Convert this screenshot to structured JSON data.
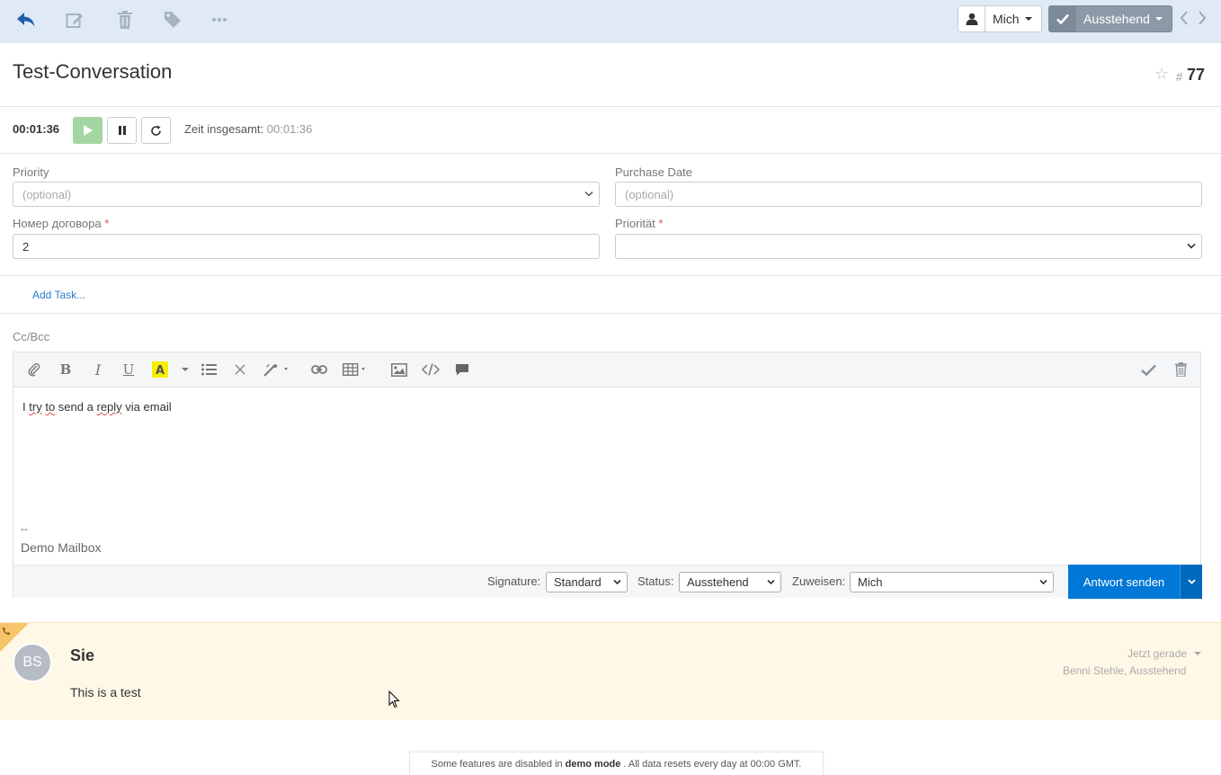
{
  "toolbar": {
    "icons": [
      "reply-icon",
      "edit-icon",
      "trash-icon",
      "tag-icon",
      "more-icon"
    ],
    "assignee_label": "Mich",
    "status_label": "Ausstehend"
  },
  "conversation": {
    "title": "Test-Conversation",
    "hash": "#",
    "number": "77"
  },
  "timer": {
    "value": "00:01:36",
    "total_label": "Zeit insgesamt:",
    "total_value": "00:01:36"
  },
  "fields": {
    "priority_label": "Priority",
    "priority_placeholder": "(optional)",
    "purchase_date_label": "Purchase Date",
    "purchase_date_placeholder": "(optional)",
    "contract_label": "Номер договора",
    "contract_value": "2",
    "prioritaet_label": "Priorität",
    "prioritaet_value": "",
    "required_mark": "*"
  },
  "tasks": {
    "add_label": "Add Task..."
  },
  "editor": {
    "ccbcc_label": "Cc/Bcc",
    "body_words": [
      "I",
      "try",
      "to",
      "send",
      "a",
      "reply",
      "via",
      "email"
    ],
    "signature_dash": "--",
    "signature_name": "Demo Mailbox",
    "footer": {
      "signature_label": "Signature:",
      "signature_value": "Standard",
      "status_label": "Status:",
      "status_value": "Ausstehend",
      "assign_label": "Zuweisen:",
      "assign_value": "Mich",
      "send_label": "Antwort senden"
    }
  },
  "thread": {
    "avatar_initials": "BS",
    "author": "Sie",
    "body": "This is a test",
    "time": "Jetzt gerade",
    "meta": "Benni Stehle, Ausstehend"
  },
  "demo_notice": {
    "prefix": "Some features are disabled in",
    "bold": "demo mode",
    "suffix": ". All data resets every day at 00:00 GMT."
  },
  "colors": {
    "topbar_bg": "#dfeaf6",
    "accent_blue": "#0078d7",
    "thread_bg": "#fff8e6",
    "play_green": "#a3d6a3"
  }
}
